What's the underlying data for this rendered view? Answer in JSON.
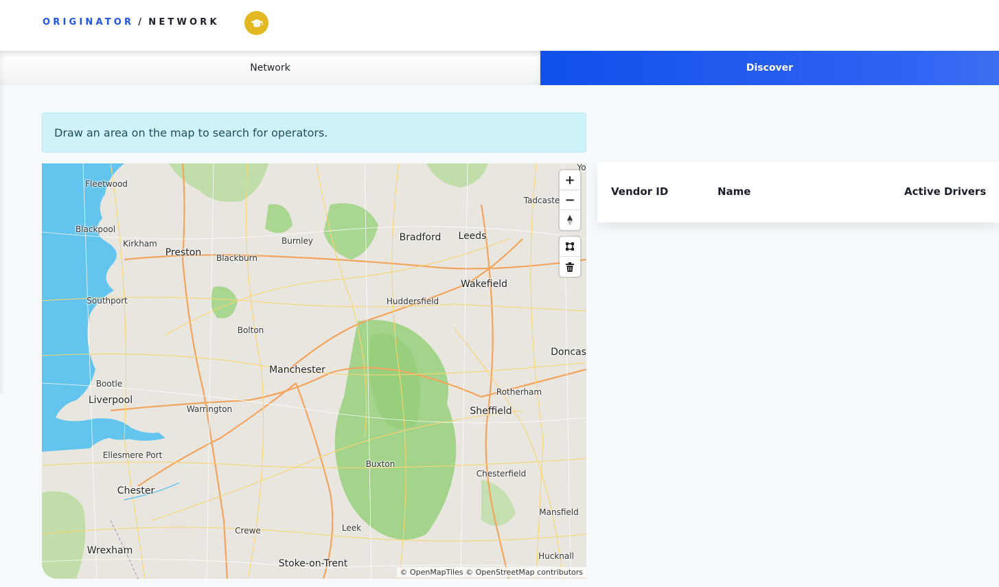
{
  "breadcrumb": {
    "root": "ORIGINATOR",
    "separator": "/",
    "current": "NETWORK"
  },
  "tabs": {
    "network": "Network",
    "discover": "Discover",
    "active": "discover"
  },
  "alert": {
    "text": "Draw an area on the map to search for operators."
  },
  "map": {
    "controls": {
      "zoom_in": "+",
      "zoom_out": "−"
    },
    "attribution": "© OpenMapTiles © OpenStreetMap contributors",
    "cities": [
      "Fleetwood",
      "Blackpool",
      "Kirkham",
      "Preston",
      "Burnley",
      "Blackburn",
      "Bradford",
      "Leeds",
      "Tadcaste",
      "Yo",
      "Wakefield",
      "Huddersfield",
      "Southport",
      "Bolton",
      "Doncas",
      "Manchester",
      "Bootle",
      "Liverpool",
      "Warrington",
      "Rotherham",
      "Sheffield",
      "Ellesmere Port",
      "Buxton",
      "Chesterfield",
      "Chester",
      "Mansfield",
      "Crewe",
      "Leek",
      "Wrexham",
      "Hucknall",
      "Stoke-on-Trent"
    ]
  },
  "table": {
    "columns": {
      "vendor_id": "Vendor ID",
      "name": "Name",
      "active_drivers": "Active Drivers"
    }
  }
}
